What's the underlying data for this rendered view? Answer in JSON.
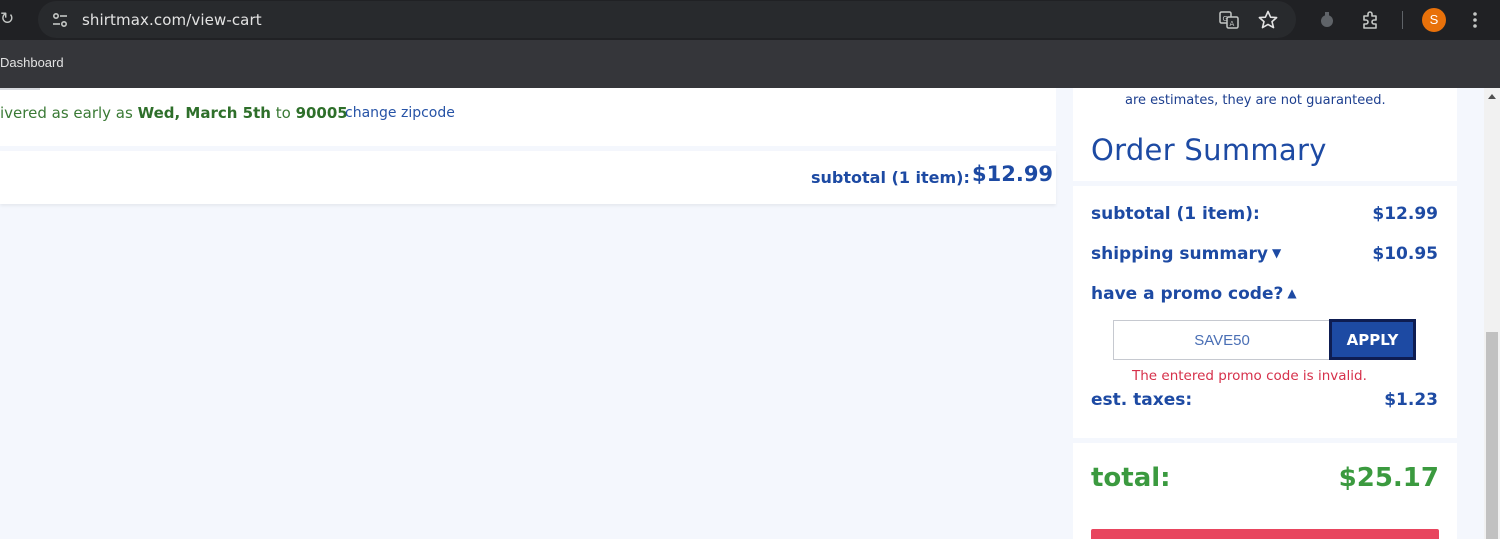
{
  "browser": {
    "url": "shirtmax.com/view-cart",
    "bookmark": "Dashboard",
    "avatar_initial": "S"
  },
  "cart": {
    "delivery_prefix": "ivered as early as ",
    "delivery_date": "Wed, March 5th",
    "delivery_to": " to ",
    "delivery_zip": "90005",
    "change_zip_label": "change zipcode",
    "subtotal_label": "subtotal (1 item):",
    "subtotal_value": "$12.99"
  },
  "summary": {
    "estimate_note": "are estimates, they are not guaranteed.",
    "title": "Order Summary",
    "subtotal_label": "subtotal (1 item):",
    "subtotal_value": "$12.99",
    "shipping_label": "shipping summary",
    "shipping_value": "$10.95",
    "promo_label": "have a promo code?",
    "promo_value": "SAVE50",
    "apply_label": "APPLY",
    "promo_error": "The entered promo code is invalid.",
    "taxes_label": "est. taxes:",
    "taxes_value": "$1.23",
    "total_label": "total:",
    "total_value": "$25.17"
  },
  "colors": {
    "brand_blue": "#1d4aa3",
    "success_green": "#3b9a3f",
    "error_red": "#d6304a",
    "checkout_pink": "#e8455e"
  }
}
